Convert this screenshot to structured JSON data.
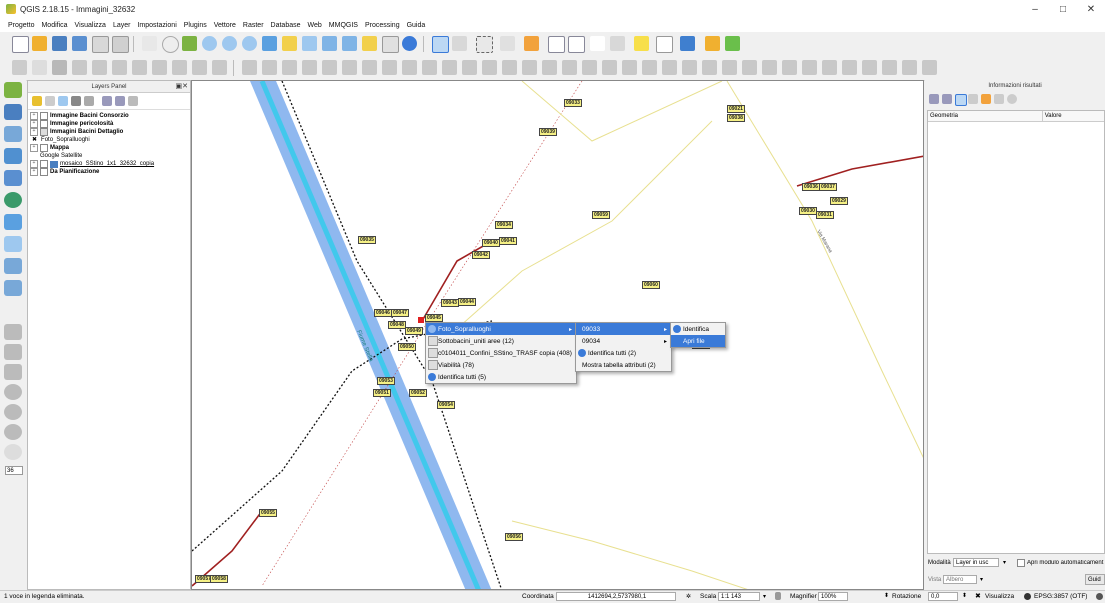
{
  "window": {
    "title": "QGIS 2.18.15 - Immagini_32632",
    "minimize": "–",
    "maximize": "□",
    "close": "✕"
  },
  "menu": [
    "Progetto",
    "Modifica",
    "Visualizza",
    "Layer",
    "Impostazioni",
    "Plugins",
    "Vettore",
    "Raster",
    "Database",
    "Web",
    "MMQGIS",
    "Processing",
    "Guida"
  ],
  "layers_panel": {
    "title": "Layers Panel",
    "items": [
      {
        "label": "Immagine Bacini Consorzio",
        "bold": true
      },
      {
        "label": "Immagine pericolosità",
        "bold": true
      },
      {
        "label": "Immagini Bacini Dettaglio",
        "bold": true
      },
      {
        "label": "Foto_Sopralluoghi",
        "bold": false
      },
      {
        "label": "Mappa",
        "bold": true
      },
      {
        "label": "Google Satellite",
        "bold": false
      },
      {
        "label": "mosaico_SStino_1x1_32632_copia",
        "bold": false
      },
      {
        "label": "Da Pianificazione",
        "bold": true
      }
    ]
  },
  "map": {
    "road_label": "Fiume Stella",
    "street_label": "Via Marana",
    "labels": [
      "09033",
      "09021",
      "09038",
      "09039",
      "09036",
      "09037",
      "09029",
      "09030",
      "09031",
      "09034",
      "09035",
      "09040",
      "09041",
      "09042",
      "09043",
      "09044",
      "09045",
      "09046",
      "09047",
      "09048",
      "09049",
      "09050",
      "09051",
      "09052",
      "09053",
      "09054",
      "09055",
      "09056",
      "09057",
      "09058",
      "09059",
      "09060",
      "09061"
    ]
  },
  "context_menu": {
    "level1": [
      {
        "label": "Foto_Sopralluoghi",
        "submenu": true,
        "selected": true
      },
      {
        "label": "Sottobacini_uniti aree (12)",
        "submenu": false
      },
      {
        "label": "c0104011_Confini_SStino_TRASF copia (408)",
        "submenu": false
      },
      {
        "label": "Viabilità (78)",
        "submenu": false
      },
      {
        "label": "Identifica tutti (5)",
        "submenu": false
      }
    ],
    "level2": [
      {
        "label": "09033",
        "submenu": true,
        "selected": true
      },
      {
        "label": "09034",
        "submenu": true,
        "selected": false
      },
      {
        "label": "Identifica tutti (2)",
        "submenu": false,
        "selected": false
      },
      {
        "label": "Mostra tabella attributi (2)",
        "submenu": false,
        "selected": false
      }
    ],
    "level3": [
      {
        "label": "Identifica",
        "selected": false
      },
      {
        "label": "Apri file",
        "selected": true
      }
    ]
  },
  "results_panel": {
    "title": "Informazioni risultati",
    "col_geometry": "Geometria",
    "col_value": "Valore",
    "mode_label": "Modalità",
    "mode_value": "Layer in usc",
    "open_form": "Apri modulo automaticament",
    "view_label": "Vista",
    "view_value": "Albero",
    "help_button": "Guid"
  },
  "statusbar": {
    "message": "1 voce in legenda eliminata.",
    "coord_label": "Coordinata",
    "coord_value": "1412694,2,5737980,1",
    "scale_label": "Scala",
    "scale_value": "1:1 143",
    "magnifier_label": "Magnifier",
    "magnifier_value": "100%",
    "rotation_label": "Rotazione",
    "rotation_value": "0,0",
    "render_label": "Visualizza",
    "crs": "EPSG:3857 (OTF)"
  },
  "left_spin_value": "36"
}
